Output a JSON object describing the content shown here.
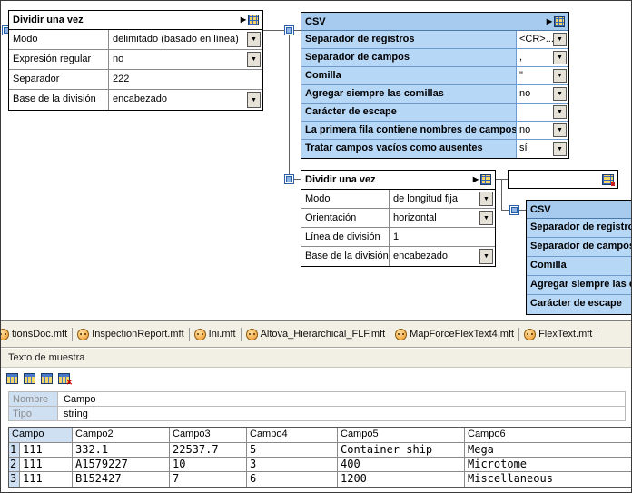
{
  "colors": {
    "csv_header_blue": "#a6cbee",
    "csv_row_blue": "#b7d7f7",
    "table_label_blue": "#cfe0f3",
    "tab_strip_beige": "#f2f0e4",
    "mft_icon_orange": "#f09828",
    "delete_red": "#d00000"
  },
  "icons": {
    "dropdown": "▼",
    "panel_arrow": "▶"
  },
  "design": {
    "split1": {
      "title": "Dividir una vez",
      "rows": [
        {
          "label": "Modo",
          "value": "delimitado (basado en línea)"
        },
        {
          "label": "Expresión regular",
          "value": "no"
        },
        {
          "label": "Separador",
          "value": "222"
        },
        {
          "label": "Base de la división",
          "value": "encabezado"
        }
      ]
    },
    "csv1": {
      "title": "CSV",
      "rows": [
        {
          "label": "Separador de registros",
          "value": "<CR>..."
        },
        {
          "label": "Separador de campos",
          "value": ","
        },
        {
          "label": "Comilla",
          "value": "\""
        },
        {
          "label": "Agregar siempre las comillas",
          "value": "no"
        },
        {
          "label": "Carácter de escape",
          "value": ""
        },
        {
          "label": "La primera fila contiene nombres de campos",
          "value": "no"
        },
        {
          "label": "Tratar campos vacíos como ausentes",
          "value": "sí"
        }
      ]
    },
    "split2": {
      "title": "Dividir una vez",
      "rows": [
        {
          "label": "Modo",
          "value": "de longitud fija"
        },
        {
          "label": "Orientación",
          "value": "horizontal"
        },
        {
          "label": "Línea de división",
          "value": "1"
        },
        {
          "label": "Base de la división",
          "value": "encabezado"
        }
      ]
    },
    "csv2": {
      "title": "CSV",
      "rows": [
        {
          "label": "Separador de registros"
        },
        {
          "label": "Separador de campos"
        },
        {
          "label": "Comilla"
        },
        {
          "label": "Agregar siempre las comillas"
        },
        {
          "label": "Carácter de escape"
        }
      ]
    }
  },
  "tabs": [
    {
      "label": "tionsDoc.mft"
    },
    {
      "label": "InspectionReport.mft"
    },
    {
      "label": "Ini.mft"
    },
    {
      "label": "Altova_Hierarchical_FLF.mft"
    },
    {
      "label": "MapForceFlexText4.mft"
    },
    {
      "label": "FlexText.mft"
    }
  ],
  "sample": {
    "title": "Texto de muestra",
    "fields": [
      {
        "label": "Nombre",
        "value": "Campo"
      },
      {
        "label": "Tipo",
        "value": "string"
      }
    ],
    "grid": {
      "headers": [
        "Campo",
        "Campo2",
        "Campo3",
        "Campo4",
        "Campo5",
        "Campo6"
      ],
      "rows": [
        {
          "num": "1",
          "cells": [
            "111",
            "332.1",
            "22537.7",
            "5",
            "Container ship",
            "Mega"
          ]
        },
        {
          "num": "2",
          "cells": [
            "111",
            "A1579227",
            "10",
            "3",
            "400",
            "Microtome"
          ]
        },
        {
          "num": "3",
          "cells": [
            "111",
            "B152427",
            "7",
            "6",
            "1200",
            "Miscellaneous"
          ]
        }
      ]
    }
  }
}
